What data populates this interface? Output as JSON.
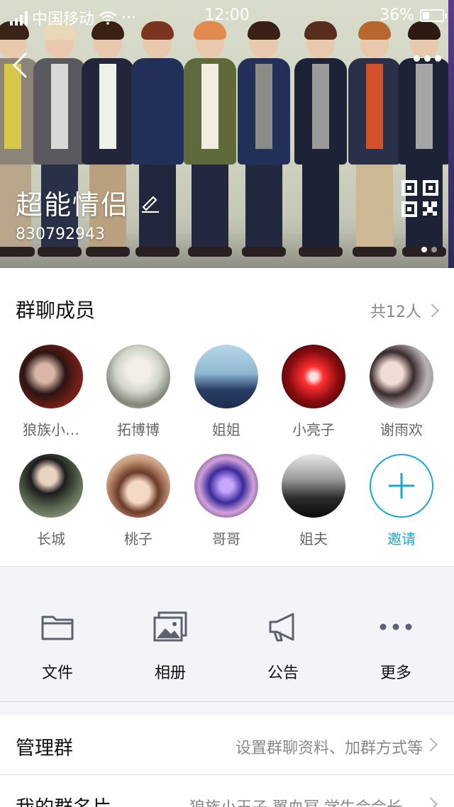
{
  "status_bar": {
    "carrier": "中国移动",
    "wifi_icon": "wifi-icon",
    "extra": "···",
    "time": "12:00",
    "battery": "36%",
    "battery_level": 0.36
  },
  "header": {
    "group_name": "超能情侣",
    "group_id": "830792943",
    "back_icon": "chevron-left-icon",
    "more_icon": "more-horizontal-icon",
    "edit_icon": "pencil-icon",
    "qr_icon": "qr-code-icon",
    "page_dots": 2,
    "active_dot": 0
  },
  "members": {
    "title": "群聊成员",
    "count": "共12人",
    "list": [
      {
        "name": "狼族小…"
      },
      {
        "name": "拓博博"
      },
      {
        "name": "姐姐"
      },
      {
        "name": "小亮子"
      },
      {
        "name": "谢雨欢"
      },
      {
        "name": "长城"
      },
      {
        "name": "桃子"
      },
      {
        "name": "哥哥"
      },
      {
        "name": "姐夫"
      }
    ],
    "invite_label": "邀请"
  },
  "tools": [
    {
      "label": "文件",
      "icon": "folder-icon"
    },
    {
      "label": "相册",
      "icon": "album-icon"
    },
    {
      "label": "公告",
      "icon": "megaphone-icon"
    },
    {
      "label": "更多",
      "icon": "more-horizontal-icon"
    }
  ],
  "rows": {
    "manage": {
      "title": "管理群",
      "value": "设置群聊资料、加群方式等"
    },
    "card": {
      "title": "我的群名片",
      "value": "狼族小王子 翼血冥 学生会会长 …"
    }
  },
  "colors": {
    "accent": "#19a7d6",
    "tool_icon": "#5d6270"
  }
}
